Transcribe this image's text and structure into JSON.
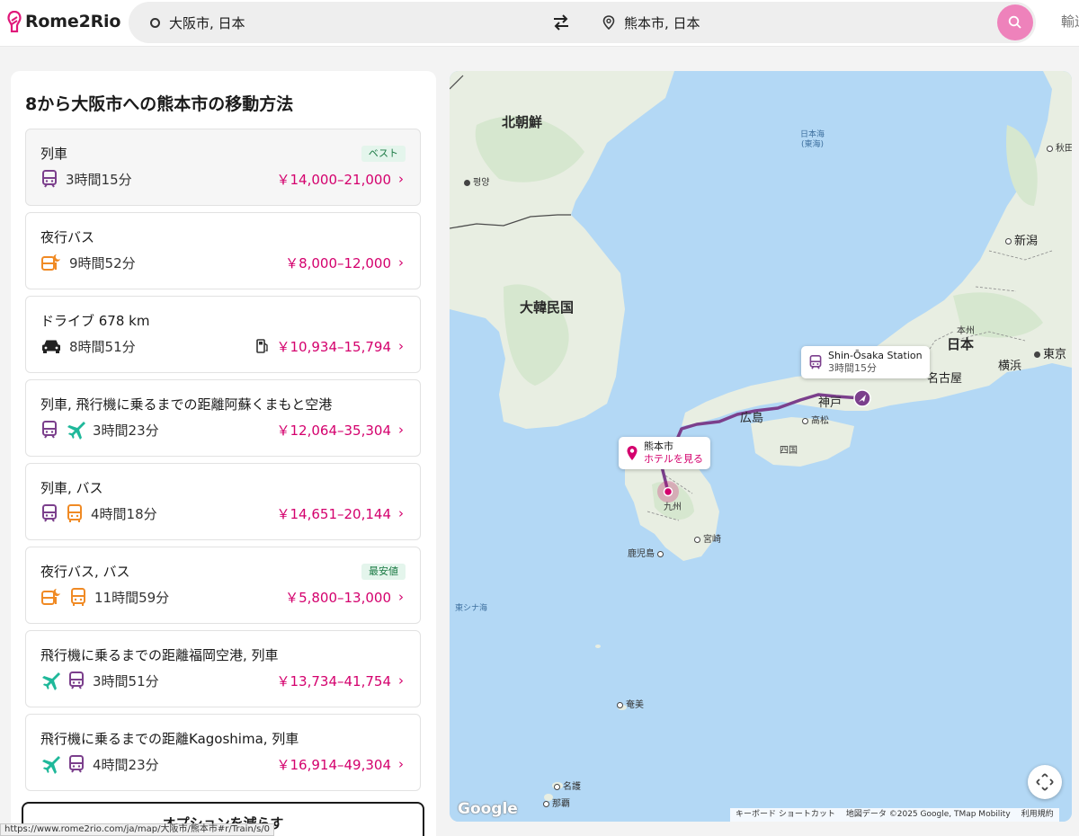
{
  "header": {
    "logo_text": "Rome2Rio",
    "origin": "大阪市, 日本",
    "destination": "熊本市, 日本",
    "right_link": "輸送"
  },
  "panel": {
    "title": "8から大阪市への熊本市の移動方法",
    "routes": [
      {
        "title": "列車",
        "badge": "ベスト",
        "duration": "3時間15分",
        "price": "￥14,000–21,000",
        "icons": [
          "train-icon"
        ]
      },
      {
        "title": "夜行バス",
        "badge": "",
        "duration": "9時間52分",
        "price": "￥8,000–12,000",
        "icons": [
          "night-bus-icon"
        ]
      },
      {
        "title": "ドライブ 678 km",
        "badge": "",
        "duration": "8時間51分",
        "price": "￥10,934–15,794",
        "icons": [
          "car-icon"
        ]
      },
      {
        "title": "列車, 飛行機に乗るまでの距離阿蘇くまもと空港",
        "badge": "",
        "duration": "3時間23分",
        "price": "￥12,064–35,304",
        "icons": [
          "train-icon",
          "plane-icon"
        ]
      },
      {
        "title": "列車, バス",
        "badge": "",
        "duration": "4時間18分",
        "price": "￥14,651–20,144",
        "icons": [
          "train-icon",
          "bus-icon"
        ]
      },
      {
        "title": "夜行バス, バス",
        "badge": "最安値",
        "duration": "11時間59分",
        "price": "￥5,800–13,000",
        "icons": [
          "night-bus-icon",
          "bus-icon"
        ]
      },
      {
        "title": "飛行機に乗るまでの距離福岡空港, 列車",
        "badge": "",
        "duration": "3時間51分",
        "price": "￥13,734–41,754",
        "icons": [
          "plane-icon",
          "train-icon"
        ]
      },
      {
        "title": "飛行機に乗るまでの距離Kagoshima, 列車",
        "badge": "",
        "duration": "4時間23分",
        "price": "￥16,914–49,304",
        "icons": [
          "plane-icon",
          "train-icon"
        ]
      }
    ],
    "more_button": "オプションを減らす"
  },
  "status_url": "https://www.rome2rio.com/ja/map/大阪市/熊本市#r/Train/s/0",
  "map": {
    "labels": {
      "north_korea": "北朝鮮",
      "pyongyang": "평양",
      "south_korea": "大韓民国",
      "sea_of_japan": "日本海\n(東海)",
      "akita": "秋田",
      "niigata": "新潟",
      "honshu": "本州",
      "japan": "日本",
      "tokyo": "東京",
      "yokohama": "横浜",
      "nagoya": "名古屋",
      "kobe": "神戸",
      "hiroshima": "広島",
      "takamatsu": "高松",
      "shikoku": "四国",
      "kyushu": "九州",
      "miyazaki": "宮崎",
      "kagoshima": "鹿児島",
      "east_china_sea": "東シナ海",
      "amami": "奄美",
      "nago": "名護",
      "naha": "那覇"
    },
    "popup_station": {
      "name": "Shin-Ōsaka Station",
      "duration": "3時間15分"
    },
    "popup_dest": {
      "name": "熊本市",
      "link": "ホテルを見る"
    },
    "google_logo": "Google",
    "attribution": {
      "shortcuts": "キーボード ショートカット",
      "data": "地図データ ©2025 Google, TMap Mobility",
      "terms": "利用規約"
    }
  },
  "colors": {
    "accent": "#d4006d",
    "search_button": "#ee82bb",
    "route": "#7b3f8c",
    "train": "#7b3f8c",
    "bus": "#f08a24",
    "plane": "#1fb89a",
    "land": "#e8eee2",
    "sea": "#b3d8f5"
  }
}
